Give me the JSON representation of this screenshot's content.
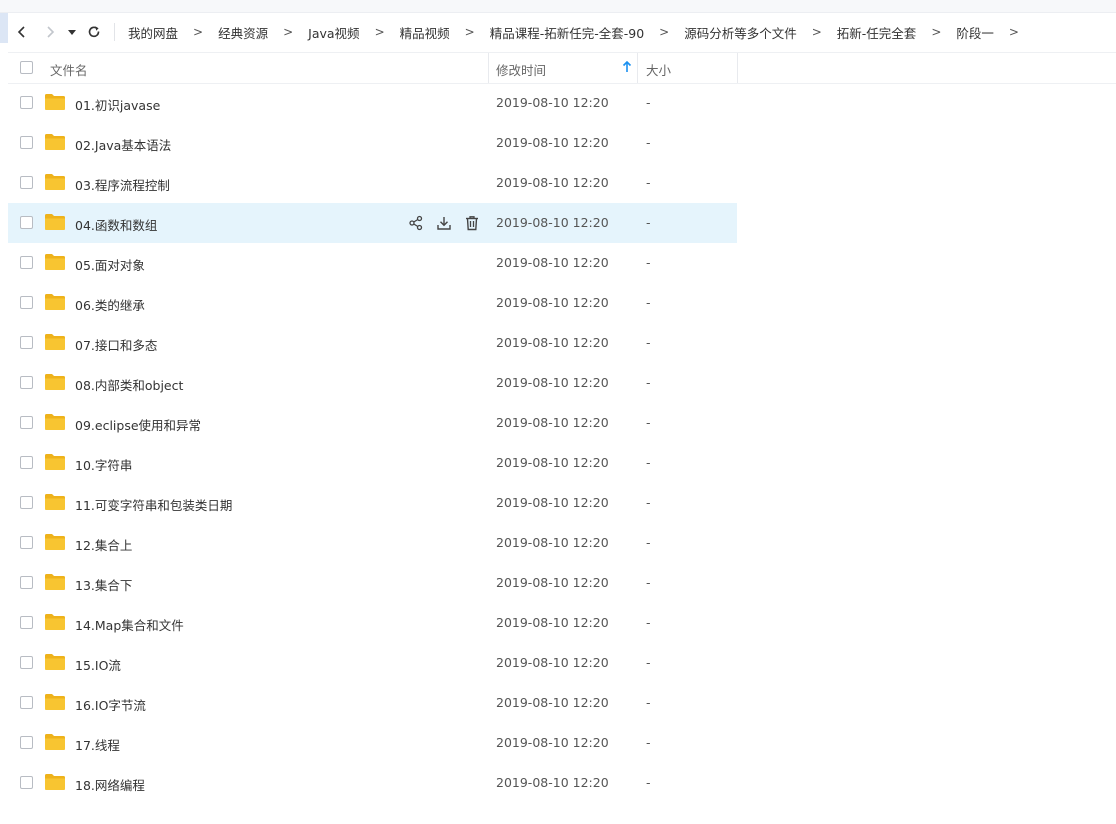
{
  "nav": {
    "breadcrumbs": [
      "我的网盘",
      "经典资源",
      "Java视频",
      "精品视频",
      "精品课程-拓新任完-全套-90",
      "源码分析等多个文件",
      "拓新-任完全套",
      "阶段一"
    ],
    "separator": ">"
  },
  "table": {
    "columns": {
      "name": "文件名",
      "modified": "修改时间",
      "size": "大小"
    },
    "sort": {
      "column": "修改时间",
      "direction": "ascending"
    },
    "hovered_row": 3,
    "rows": [
      {
        "name": "01.初识javase",
        "modified": "2019-08-10 12:20",
        "size": "-"
      },
      {
        "name": "02.Java基本语法",
        "modified": "2019-08-10 12:20",
        "size": "-"
      },
      {
        "name": "03.程序流程控制",
        "modified": "2019-08-10 12:20",
        "size": "-"
      },
      {
        "name": "04.函数和数组",
        "modified": "2019-08-10 12:20",
        "size": "-"
      },
      {
        "name": "05.面对对象",
        "modified": "2019-08-10 12:20",
        "size": "-"
      },
      {
        "name": "06.类的继承",
        "modified": "2019-08-10 12:20",
        "size": "-"
      },
      {
        "name": "07.接口和多态",
        "modified": "2019-08-10 12:20",
        "size": "-"
      },
      {
        "name": "08.内部类和object",
        "modified": "2019-08-10 12:20",
        "size": "-"
      },
      {
        "name": "09.eclipse使用和异常",
        "modified": "2019-08-10 12:20",
        "size": "-"
      },
      {
        "name": "10.字符串",
        "modified": "2019-08-10 12:20",
        "size": "-"
      },
      {
        "name": "11.可变字符串和包装类日期",
        "modified": "2019-08-10 12:20",
        "size": "-"
      },
      {
        "name": "12.集合上",
        "modified": "2019-08-10 12:20",
        "size": "-"
      },
      {
        "name": "13.集合下",
        "modified": "2019-08-10 12:20",
        "size": "-"
      },
      {
        "name": "14.Map集合和文件",
        "modified": "2019-08-10 12:20",
        "size": "-"
      },
      {
        "name": "15.IO流",
        "modified": "2019-08-10 12:20",
        "size": "-"
      },
      {
        "name": "16.IO字节流",
        "modified": "2019-08-10 12:20",
        "size": "-"
      },
      {
        "name": "17.线程",
        "modified": "2019-08-10 12:20",
        "size": "-"
      },
      {
        "name": "18.网络编程",
        "modified": "2019-08-10 12:20",
        "size": "-"
      }
    ]
  },
  "colors": {
    "folder": "#f8c531",
    "folder_dark": "#eeb21b",
    "hover_row": "#e5f4fc",
    "accent": "#1a90f0"
  },
  "icons": {
    "back": "chevron-left-icon",
    "forward": "chevron-right-icon",
    "history": "dropdown-triangle-icon",
    "refresh": "refresh-icon",
    "folder": "folder-icon",
    "share": "share-icon",
    "download": "download-icon",
    "delete": "trash-icon",
    "sort": "arrow-up-icon"
  }
}
